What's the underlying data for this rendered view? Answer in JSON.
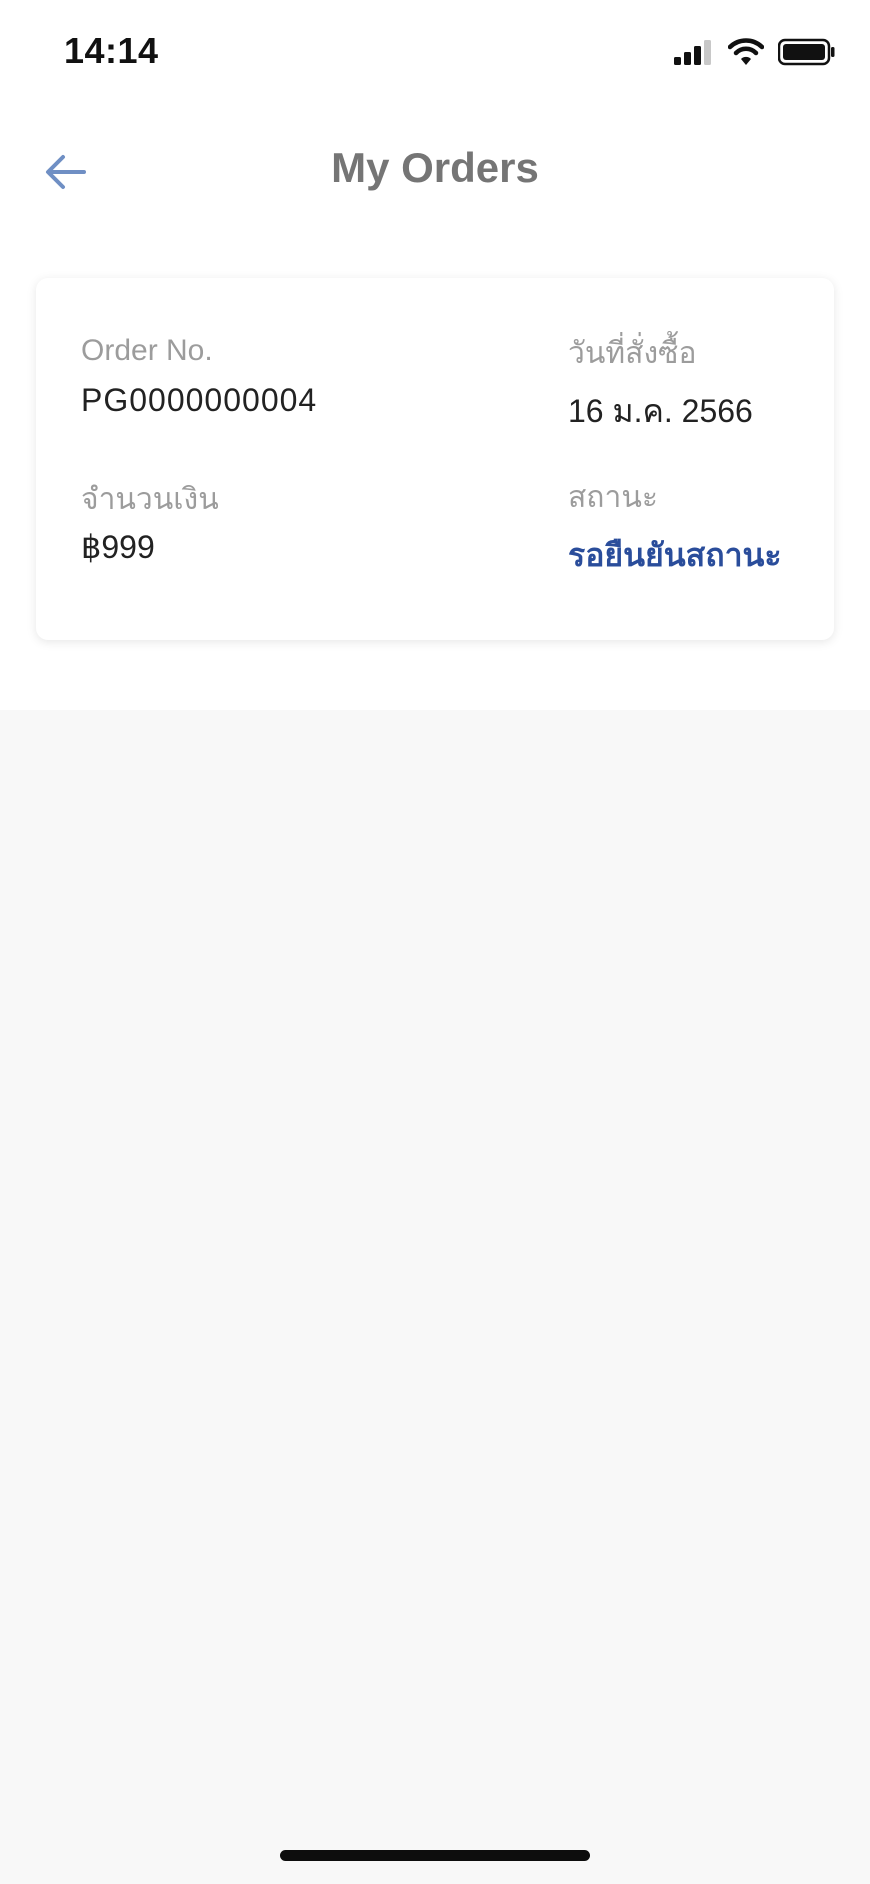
{
  "status_bar": {
    "time": "14:14",
    "icons": [
      "cellular-signal-icon",
      "wifi-icon",
      "battery-icon"
    ]
  },
  "nav": {
    "title": "My Orders",
    "back_icon": "arrow-left-icon"
  },
  "order": {
    "order_no_label": "Order No.",
    "order_no": "PG0000000004",
    "date_label": "วันที่สั่งซื้อ",
    "date": "16 ม.ค. 2566",
    "amount_label": "จำนวนเงิน",
    "amount": "฿999",
    "status_label": "สถานะ",
    "status": "รอยืนยันสถานะ"
  },
  "colors": {
    "accent_blue": "#2a4d9b",
    "back_arrow": "#6f8fc4",
    "title_gray": "#757575",
    "label_gray": "#9c9c9c",
    "background_gray": "#f8f8f8"
  }
}
